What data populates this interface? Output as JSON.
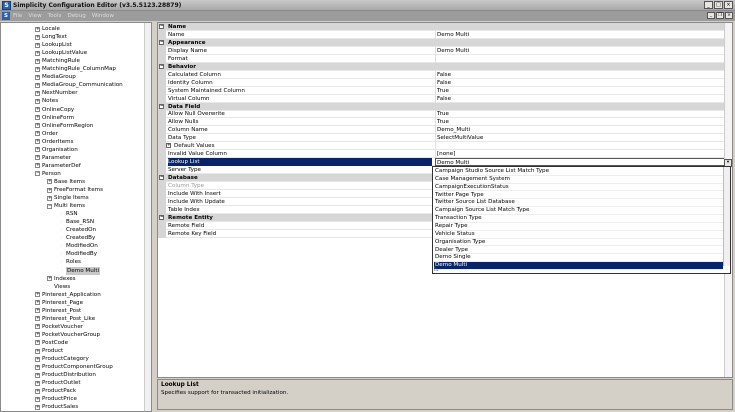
{
  "window": {
    "title": "Simplicity Configuration Editor (v3.5.5123.28879)",
    "min_glyph": "_",
    "max_glyph": "□",
    "close_glyph": "×",
    "app_letter": "S"
  },
  "menu": {
    "items": [
      "File",
      "View",
      "Tools",
      "Debug",
      "Window"
    ],
    "mdi_min": "_",
    "mdi_restore": "❐",
    "mdi_close": "×"
  },
  "tree": {
    "items": [
      {
        "label": "Locale",
        "level": 1,
        "expander": "+"
      },
      {
        "label": "LongText",
        "level": 1,
        "expander": "+"
      },
      {
        "label": "LookupList",
        "level": 1,
        "expander": "+"
      },
      {
        "label": "LookupListValue",
        "level": 1,
        "expander": "+"
      },
      {
        "label": "MatchingRule",
        "level": 1,
        "expander": "+"
      },
      {
        "label": "MatchingRule_ColumnMap",
        "level": 1,
        "expander": "+"
      },
      {
        "label": "MediaGroup",
        "level": 1,
        "expander": "+"
      },
      {
        "label": "MediaGroup_Communication",
        "level": 1,
        "expander": "+"
      },
      {
        "label": "NextNumber",
        "level": 1,
        "expander": "+"
      },
      {
        "label": "Notes",
        "level": 1,
        "expander": "+"
      },
      {
        "label": "OnlineCopy",
        "level": 1,
        "expander": "+"
      },
      {
        "label": "OnlineForm",
        "level": 1,
        "expander": "+"
      },
      {
        "label": "OnlineFormRegion",
        "level": 1,
        "expander": "+"
      },
      {
        "label": "Order",
        "level": 1,
        "expander": "+"
      },
      {
        "label": "OrderItems",
        "level": 1,
        "expander": "+"
      },
      {
        "label": "Organisation",
        "level": 1,
        "expander": "+"
      },
      {
        "label": "Parameter",
        "level": 1,
        "expander": "+"
      },
      {
        "label": "ParameterDef",
        "level": 1,
        "expander": "+"
      },
      {
        "label": "Person",
        "level": 1,
        "expander": "−"
      },
      {
        "label": "Base Items",
        "level": 2,
        "expander": "+"
      },
      {
        "label": "FreeFormat Items",
        "level": 2,
        "expander": "+"
      },
      {
        "label": "Single Items",
        "level": 2,
        "expander": "+"
      },
      {
        "label": "Multi Items",
        "level": 2,
        "expander": "−"
      },
      {
        "label": "RSN",
        "level": 3,
        "expander": ""
      },
      {
        "label": "Base_RSN",
        "level": 3,
        "expander": ""
      },
      {
        "label": "CreatedOn",
        "level": 3,
        "expander": ""
      },
      {
        "label": "CreatedBy",
        "level": 3,
        "expander": ""
      },
      {
        "label": "ModifiedOn",
        "level": 3,
        "expander": ""
      },
      {
        "label": "ModifiedBy",
        "level": 3,
        "expander": ""
      },
      {
        "label": "Roles",
        "level": 3,
        "expander": ""
      },
      {
        "label": "Demo Multi",
        "level": 3,
        "expander": "",
        "selected": true
      },
      {
        "label": "Indexes",
        "level": 2,
        "expander": "+"
      },
      {
        "label": "Views",
        "level": 2,
        "expander": ""
      },
      {
        "label": "Pinterest_Application",
        "level": 1,
        "expander": "+"
      },
      {
        "label": "Pinterest_Page",
        "level": 1,
        "expander": "+"
      },
      {
        "label": "Pinterest_Post",
        "level": 1,
        "expander": "+"
      },
      {
        "label": "Pinterest_Post_Like",
        "level": 1,
        "expander": "+"
      },
      {
        "label": "PocketVoucher",
        "level": 1,
        "expander": "+"
      },
      {
        "label": "PocketVoucherGroup",
        "level": 1,
        "expander": "+"
      },
      {
        "label": "PostCode",
        "level": 1,
        "expander": "+"
      },
      {
        "label": "Product",
        "level": 1,
        "expander": "+"
      },
      {
        "label": "ProductCategory",
        "level": 1,
        "expander": "+"
      },
      {
        "label": "ProductComponentGroup",
        "level": 1,
        "expander": "+"
      },
      {
        "label": "ProductDistribution",
        "level": 1,
        "expander": "+"
      },
      {
        "label": "ProductOutlet",
        "level": 1,
        "expander": "+"
      },
      {
        "label": "ProductPack",
        "level": 1,
        "expander": "+"
      },
      {
        "label": "ProductPrice",
        "level": 1,
        "expander": "+"
      },
      {
        "label": "ProductSales",
        "level": 1,
        "expander": "+"
      }
    ]
  },
  "grid": {
    "rows": [
      {
        "type": "cat",
        "name": "Name",
        "expander": "−"
      },
      {
        "type": "prop",
        "name": "Name",
        "value": "Demo Multi"
      },
      {
        "type": "cat",
        "name": "Appearance",
        "expander": "−"
      },
      {
        "type": "prop",
        "name": "Display Name",
        "value": "Demo Multi"
      },
      {
        "type": "prop",
        "name": "Format",
        "value": ""
      },
      {
        "type": "cat",
        "name": "Behavior",
        "expander": "−"
      },
      {
        "type": "prop",
        "name": "Calculated Column",
        "value": "False"
      },
      {
        "type": "prop",
        "name": "Identity Column",
        "value": "False"
      },
      {
        "type": "prop",
        "name": "System Maintained Column",
        "value": "True"
      },
      {
        "type": "prop",
        "name": "Virtual Column",
        "value": "False"
      },
      {
        "type": "cat",
        "name": "Data Field",
        "expander": "−"
      },
      {
        "type": "prop",
        "name": "Allow Null Overwrite",
        "value": "True"
      },
      {
        "type": "prop",
        "name": "Allow Nulls",
        "value": "True"
      },
      {
        "type": "prop",
        "name": "Column Name",
        "value": "Demo_Multi"
      },
      {
        "type": "prop",
        "name": "Data Type",
        "value": "SelectMultiValue"
      },
      {
        "type": "prop",
        "name": "Default Values",
        "value": "",
        "expander": "+"
      },
      {
        "type": "prop",
        "name": "Invalid Value Column",
        "value": "[none]"
      },
      {
        "type": "prop",
        "name": "Lookup List",
        "value": "Demo Multi",
        "selected": true
      },
      {
        "type": "prop",
        "name": "Server Type",
        "value": ""
      },
      {
        "type": "cat",
        "name": "Database",
        "expander": "−"
      },
      {
        "type": "prop",
        "name": "Column Type",
        "value": "",
        "disabled": true
      },
      {
        "type": "prop",
        "name": "Include With Insert",
        "value": ""
      },
      {
        "type": "prop",
        "name": "Include With Update",
        "value": ""
      },
      {
        "type": "prop",
        "name": "Table Index",
        "value": ""
      },
      {
        "type": "cat",
        "name": "Remote Entity",
        "expander": "−"
      },
      {
        "type": "prop",
        "name": "Remote Field",
        "value": ""
      },
      {
        "type": "prop",
        "name": "Remote Key Field",
        "value": ""
      }
    ],
    "combo_glyph": "▾"
  },
  "dropdown": {
    "options": [
      "Campaign Studio Source List Match Type",
      "Case Management System",
      "CampaignExecutionStatus",
      "Twitter Page Type",
      "Twitter Source List Database",
      "Campaign Source List Match Type",
      "Transaction Type",
      "Repair Type",
      "Vehicle Status",
      "Organisation Type",
      "Dealer Type",
      "Demo Single",
      "Demo Multi"
    ],
    "selected_index": 12,
    "resize_glyph": "◺"
  },
  "description": {
    "title": "Lookup List",
    "text": "Specifies support for transacted initialization."
  }
}
